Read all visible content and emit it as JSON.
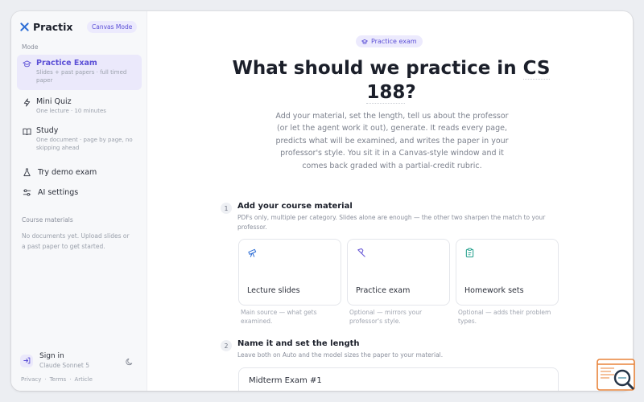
{
  "app": {
    "name": "Practix",
    "mode_badge": "Canvas Mode"
  },
  "sidebar": {
    "mode_label": "Mode",
    "modes": [
      {
        "title": "Practice Exam",
        "subtitle": "Slides + past papers · full timed paper",
        "active": true
      },
      {
        "title": "Mini Quiz",
        "subtitle": "One lecture · 10 minutes"
      },
      {
        "title": "Study",
        "subtitle": "One document · page by page, no skipping ahead"
      }
    ],
    "links": [
      {
        "label": "Try demo exam"
      },
      {
        "label": "AI settings"
      }
    ],
    "materials_label": "Course materials",
    "materials_empty": "No documents yet. Upload slides or a past paper to get started.",
    "user": {
      "signin": "Sign in",
      "model": "Claude Sonnet 5"
    },
    "footer": {
      "privacy": "Privacy",
      "sep": "·",
      "terms": "Terms",
      "article": "Article"
    }
  },
  "main": {
    "pill": "Practice exam",
    "headline_pre": "What should we practice in",
    "course": "CS 188",
    "headline_post": "?",
    "intro": "Add your material, set the length, tell us about the professor (or let the agent work it out), generate. It reads every page, predicts what will be examined, and writes the paper in your professor's style. You sit it in a Canvas-style window and it comes back graded with a partial-credit rubric.",
    "step1": {
      "num": "1",
      "title": "Add your course material",
      "desc": "PDFs only, multiple per category. Slides alone are enough — the other two sharpen the match to your professor."
    },
    "cards": [
      {
        "label": "Lecture slides",
        "caption": "Main source — what gets examined."
      },
      {
        "label": "Practice exam",
        "caption": "Optional — mirrors your professor's style."
      },
      {
        "label": "Homework sets",
        "caption": "Optional — adds their problem types."
      }
    ],
    "step2": {
      "num": "2",
      "title": "Name it and set the length",
      "desc": "Leave both on Auto and the model sizes the paper to your material."
    },
    "exam_name": "Midterm Exam #1"
  },
  "colors": {
    "accent": "#5b4fd6",
    "accent_soft": "#ebe9fb",
    "teal": "#1f9e8a"
  }
}
